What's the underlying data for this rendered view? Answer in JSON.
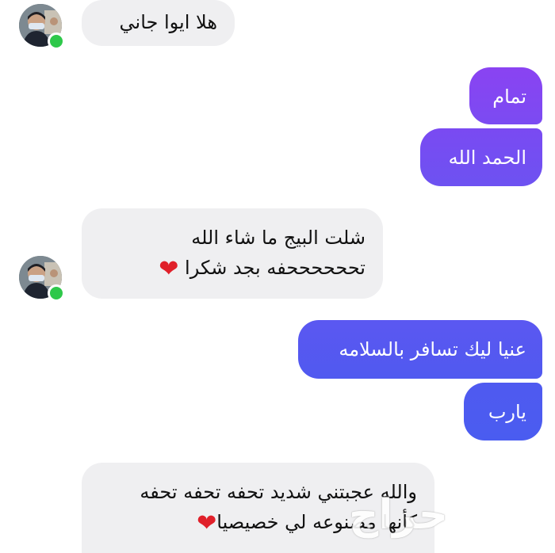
{
  "colors": {
    "incoming_bubble": "#efeff1",
    "outgoing_gradient_top": "#8a43f2",
    "outgoing_gradient_bottom": "#4d5cf0",
    "online_dot": "#2ec84a"
  },
  "messages": [
    {
      "direction": "incoming",
      "lines": [
        "هلا ايوا جاني"
      ]
    },
    {
      "direction": "outgoing",
      "lines": [
        "تمام"
      ]
    },
    {
      "direction": "outgoing",
      "lines": [
        "الحمد الله"
      ]
    },
    {
      "direction": "incoming",
      "lines": [
        "شلت البيج ما شاء الله",
        "تححححححفه بجد شكرا"
      ],
      "emoji": "heart"
    },
    {
      "direction": "outgoing",
      "lines": [
        "عنيا ليك تسافر بالسلامه"
      ]
    },
    {
      "direction": "outgoing",
      "lines": [
        "يارب"
      ]
    },
    {
      "direction": "incoming",
      "lines": [
        "والله عجبتني شديد تحفه تحفه تحفه",
        "كأنها مصنوعه لي خصيصيا"
      ],
      "emoji": "heart"
    }
  ],
  "heart_glyph": "❤",
  "watermark": "حراج"
}
